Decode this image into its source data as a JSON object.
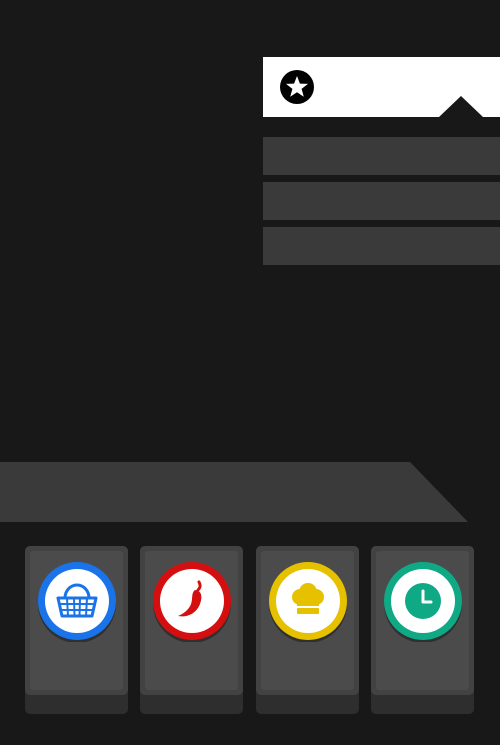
{
  "header": {
    "badge_icon": "star-icon"
  },
  "menu": {
    "items": [
      {
        "id": "menu-item-1"
      },
      {
        "id": "menu-item-2"
      },
      {
        "id": "menu-item-3"
      }
    ]
  },
  "categories": [
    {
      "icon": "basket-icon",
      "color": "#1a73e8"
    },
    {
      "icon": "chili-pepper-icon",
      "color": "#d50f0f"
    },
    {
      "icon": "chef-hat-icon",
      "color": "#e6c100"
    },
    {
      "icon": "clock-icon",
      "color": "#10a985"
    }
  ],
  "theme": {
    "background": "#181818",
    "panel": "#3a3a3a",
    "card": "#ffffff"
  }
}
